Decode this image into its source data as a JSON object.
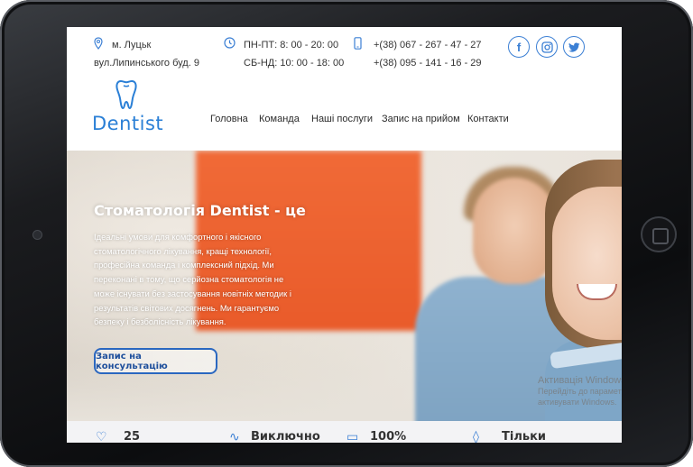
{
  "contact": {
    "address_line1": "м. Луцьк",
    "address_line2": "вул.Липинського буд. 9",
    "hours_line1": "ПН-ПТ: 8: 00 - 20: 00",
    "hours_line2": "СБ-НД: 10: 00 - 18: 00",
    "phone_line1": "+(38) 067 - 267 - 47 - 27",
    "phone_line2": "+(38) 095 - 141 - 16 - 29"
  },
  "social": {
    "facebook": "f",
    "instagram": "◎",
    "twitter": "t"
  },
  "logo": {
    "text": "Dentist",
    "icon": "tooth-icon"
  },
  "nav": [
    "Головна",
    "Команда",
    "Наші послуги",
    "Запис на прийом",
    "Контакти"
  ],
  "hero": {
    "title": "Стоматологія Dentist - це",
    "text_lines": [
      "Ідеальні умови для комфортного і якісного",
      "стоматологічного лікування, кращі технології,",
      "професійна команда і комплексний підхід. Ми",
      "переконані в тому, що серйозна стоматологія не",
      "може існувати без застосування новітніх методик і",
      "результатів світових досягнень. Ми гарантуємо",
      "безпеку і безболісність лікування."
    ],
    "button": "Запис на консультацію"
  },
  "watermark": {
    "title": "Активація Windows",
    "line1": "Перейдіть до параметрів, щоб",
    "line2": "активувати Windows."
  },
  "features": [
    "25",
    "Виключно",
    "100%",
    "Тільки"
  ],
  "colors": {
    "accent": "#2a7fd6",
    "button_border": "#2a67c0",
    "hero_orange": "#ef6433"
  }
}
